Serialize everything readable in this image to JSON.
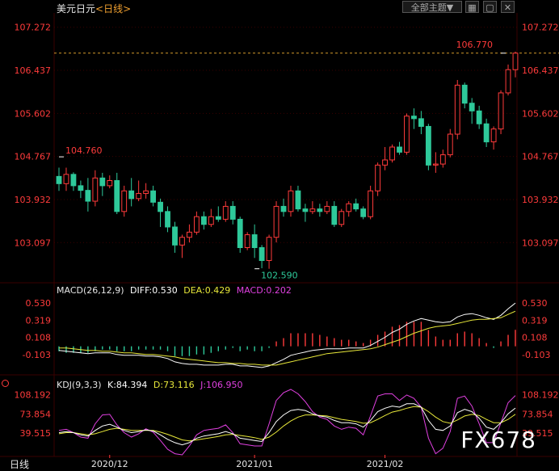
{
  "header": {
    "title": "美元日元",
    "period": "<日线>",
    "menu_label": "全部主题▼",
    "button_icons": [
      "grid-icon",
      "window-icon",
      "close-icon"
    ]
  },
  "bottom": {
    "period_label": "日线"
  },
  "watermark": "FX678",
  "colors": {
    "up": "#ff3b3b",
    "down": "#2ec99a",
    "axis": "#ff3b3b",
    "grid": "#3a0000",
    "diff": "#ffffff",
    "dea": "#e8e83a",
    "macd": "#e040e0",
    "k": "#ffffff",
    "d": "#e8e83a",
    "j": "#e040e0"
  },
  "chart_data": [
    {
      "type": "candlestick",
      "title": "美元日元<日线>",
      "y_ticks": [
        107.272,
        106.437,
        105.602,
        104.767,
        103.932,
        103.097
      ],
      "y_tick_labels": [
        "107.272",
        "106.437",
        "105.602",
        "104.767",
        "103.932",
        "103.097"
      ],
      "ylim": [
        102.35,
        107.55
      ],
      "x_tick_labels": [
        "2020/12",
        "2021/01",
        "2021/02"
      ],
      "x_tick_index": [
        7,
        27,
        45
      ],
      "annotations": [
        {
          "text": "104.760",
          "index": 0,
          "value": 104.76
        },
        {
          "text": "102.590",
          "index": 27,
          "value": 102.59
        },
        {
          "text": "106.770",
          "index": 61,
          "value": 106.77
        }
      ],
      "reference_line": 106.77,
      "candles": [
        [
          104.38,
          104.24,
          104.55,
          104.1
        ],
        [
          104.24,
          104.42,
          104.55,
          104.1
        ],
        [
          104.42,
          104.2,
          104.46,
          104.1
        ],
        [
          104.2,
          104.11,
          104.3,
          103.96
        ],
        [
          104.11,
          103.9,
          104.35,
          103.7
        ],
        [
          103.9,
          104.35,
          104.5,
          103.8
        ],
        [
          104.35,
          104.2,
          104.45,
          104.0
        ],
        [
          104.2,
          104.3,
          104.4,
          104.15
        ],
        [
          104.3,
          103.7,
          104.45,
          103.65
        ],
        [
          103.7,
          104.1,
          104.2,
          103.6
        ],
        [
          104.1,
          103.95,
          104.35,
          103.8
        ],
        [
          103.95,
          104.05,
          104.3,
          103.9
        ],
        [
          104.05,
          104.1,
          104.25,
          103.95
        ],
        [
          104.1,
          103.88,
          104.2,
          103.8
        ],
        [
          103.88,
          103.7,
          103.95,
          103.4
        ],
        [
          103.7,
          103.4,
          103.8,
          103.3
        ],
        [
          103.4,
          103.05,
          103.5,
          102.9
        ],
        [
          103.05,
          103.2,
          103.25,
          102.8
        ],
        [
          103.2,
          103.3,
          103.45,
          103.1
        ],
        [
          103.3,
          103.6,
          103.7,
          103.25
        ],
        [
          103.6,
          103.45,
          103.7,
          103.35
        ],
        [
          103.45,
          103.6,
          103.75,
          103.4
        ],
        [
          103.6,
          103.55,
          103.8,
          103.5
        ],
        [
          103.55,
          103.8,
          103.9,
          103.5
        ],
        [
          103.8,
          103.55,
          103.9,
          103.45
        ],
        [
          103.55,
          103.0,
          103.6,
          102.9
        ],
        [
          103.0,
          103.25,
          103.3,
          102.95
        ],
        [
          103.25,
          103.0,
          103.45,
          102.8
        ],
        [
          103.0,
          102.75,
          103.05,
          102.6
        ],
        [
          102.75,
          103.2,
          103.25,
          102.59
        ],
        [
          103.2,
          103.8,
          103.9,
          103.1
        ],
        [
          103.8,
          103.7,
          103.95,
          103.6
        ],
        [
          103.7,
          104.1,
          104.2,
          103.6
        ],
        [
          104.1,
          103.75,
          104.2,
          103.7
        ],
        [
          103.75,
          103.7,
          103.85,
          103.5
        ],
        [
          103.7,
          103.75,
          103.9,
          103.65
        ],
        [
          103.75,
          103.7,
          103.85,
          103.6
        ],
        [
          103.7,
          103.8,
          103.9,
          103.65
        ],
        [
          103.8,
          103.45,
          103.9,
          103.4
        ],
        [
          103.45,
          103.7,
          103.75,
          103.4
        ],
        [
          103.7,
          103.85,
          103.9,
          103.6
        ],
        [
          103.85,
          103.75,
          103.95,
          103.7
        ],
        [
          103.75,
          103.6,
          103.8,
          103.55
        ],
        [
          103.6,
          104.1,
          104.2,
          103.55
        ],
        [
          104.1,
          104.6,
          104.65,
          104.0
        ],
        [
          104.6,
          104.7,
          104.95,
          104.5
        ],
        [
          104.7,
          104.95,
          105.0,
          104.65
        ],
        [
          104.95,
          104.85,
          105.05,
          104.8
        ],
        [
          104.85,
          105.55,
          105.6,
          104.8
        ],
        [
          105.55,
          105.5,
          105.7,
          105.3
        ],
        [
          105.5,
          105.35,
          105.65,
          105.2
        ],
        [
          105.35,
          104.6,
          105.4,
          104.5
        ],
        [
          104.6,
          104.62,
          104.85,
          104.45
        ],
        [
          104.62,
          104.8,
          104.9,
          104.55
        ],
        [
          104.8,
          105.2,
          105.3,
          104.75
        ],
        [
          105.2,
          106.15,
          106.25,
          105.1
        ],
        [
          106.15,
          105.8,
          106.2,
          105.7
        ],
        [
          105.8,
          105.65,
          105.9,
          105.4
        ],
        [
          105.65,
          105.4,
          105.75,
          105.3
        ],
        [
          105.4,
          105.05,
          105.5,
          104.95
        ],
        [
          105.05,
          105.3,
          105.35,
          104.9
        ],
        [
          105.3,
          106.0,
          106.05,
          105.2
        ],
        [
          106.0,
          106.45,
          106.55,
          105.95
        ],
        [
          106.45,
          106.77,
          106.8,
          106.3
        ]
      ]
    },
    {
      "type": "macd",
      "title": "MACD(26,12,9)",
      "params": "(26,12,9)",
      "legend": {
        "diff": "DIFF:0.530",
        "dea": "DEA:0.429",
        "macd": "MACD:0.202"
      },
      "y_ticks": [
        0.53,
        0.319,
        0.108,
        -0.103
      ],
      "y_tick_labels": [
        "0.530",
        "0.319",
        "0.108",
        "-0.103"
      ],
      "ylim": [
        -0.33,
        0.62
      ],
      "diff": [
        -0.05,
        -0.06,
        -0.07,
        -0.08,
        -0.09,
        -0.08,
        -0.08,
        -0.08,
        -0.1,
        -0.11,
        -0.11,
        -0.11,
        -0.12,
        -0.12,
        -0.13,
        -0.15,
        -0.19,
        -0.21,
        -0.22,
        -0.22,
        -0.23,
        -0.23,
        -0.23,
        -0.22,
        -0.22,
        -0.24,
        -0.24,
        -0.25,
        -0.26,
        -0.24,
        -0.2,
        -0.16,
        -0.11,
        -0.09,
        -0.07,
        -0.05,
        -0.04,
        -0.03,
        -0.03,
        -0.03,
        -0.02,
        -0.02,
        -0.02,
        0.01,
        0.06,
        0.11,
        0.17,
        0.21,
        0.27,
        0.31,
        0.34,
        0.32,
        0.3,
        0.29,
        0.3,
        0.36,
        0.39,
        0.4,
        0.38,
        0.35,
        0.33,
        0.38,
        0.46,
        0.53
      ],
      "dea": [
        -0.02,
        -0.02,
        -0.03,
        -0.04,
        -0.05,
        -0.05,
        -0.06,
        -0.06,
        -0.07,
        -0.08,
        -0.08,
        -0.09,
        -0.1,
        -0.1,
        -0.11,
        -0.12,
        -0.13,
        -0.15,
        -0.16,
        -0.17,
        -0.18,
        -0.19,
        -0.2,
        -0.2,
        -0.21,
        -0.21,
        -0.22,
        -0.22,
        -0.23,
        -0.23,
        -0.23,
        -0.21,
        -0.19,
        -0.17,
        -0.15,
        -0.13,
        -0.11,
        -0.09,
        -0.08,
        -0.07,
        -0.06,
        -0.05,
        -0.04,
        -0.03,
        -0.01,
        0.02,
        0.05,
        0.08,
        0.12,
        0.16,
        0.19,
        0.22,
        0.24,
        0.25,
        0.26,
        0.28,
        0.3,
        0.32,
        0.33,
        0.33,
        0.34,
        0.35,
        0.39,
        0.43
      ],
      "macd": [
        -0.06,
        -0.08,
        -0.08,
        -0.08,
        -0.08,
        -0.06,
        -0.04,
        -0.04,
        -0.06,
        -0.06,
        -0.06,
        -0.04,
        -0.04,
        -0.04,
        -0.04,
        -0.06,
        -0.12,
        -0.12,
        -0.12,
        -0.1,
        -0.1,
        -0.08,
        -0.06,
        -0.04,
        -0.02,
        -0.06,
        -0.04,
        -0.06,
        -0.06,
        -0.02,
        0.06,
        0.1,
        0.16,
        0.16,
        0.16,
        0.16,
        0.14,
        0.12,
        0.1,
        0.08,
        0.08,
        0.06,
        0.04,
        0.08,
        0.14,
        0.18,
        0.24,
        0.26,
        0.3,
        0.3,
        0.3,
        0.2,
        0.12,
        0.08,
        0.08,
        0.16,
        0.18,
        0.16,
        0.1,
        0.04,
        -0.02,
        0.06,
        0.14,
        0.202
      ]
    },
    {
      "type": "kdj",
      "title": "KDJ(9,3,3)",
      "params": "(9,3,3)",
      "legend": {
        "k": "K:84.394",
        "d": "D:73.116",
        "j": "J:106.950"
      },
      "y_ticks": [
        108.192,
        73.854,
        39.515
      ],
      "y_tick_labels": [
        "108.192",
        "73.854",
        "39.515"
      ],
      "ylim": [
        0,
        118
      ],
      "k": [
        40,
        42,
        40,
        36,
        34,
        44,
        52,
        55,
        50,
        44,
        40,
        42,
        45,
        43,
        36,
        28,
        22,
        18,
        22,
        30,
        34,
        36,
        38,
        42,
        38,
        30,
        28,
        26,
        24,
        40,
        60,
        72,
        80,
        82,
        80,
        74,
        70,
        68,
        62,
        58,
        58,
        56,
        50,
        62,
        78,
        84,
        88,
        86,
        92,
        92,
        86,
        62,
        46,
        44,
        52,
        76,
        82,
        78,
        66,
        50,
        46,
        58,
        74,
        84.394
      ],
      "d": [
        38,
        40,
        40,
        38,
        36,
        38,
        42,
        46,
        48,
        46,
        44,
        44,
        44,
        44,
        41,
        37,
        32,
        27,
        25,
        27,
        29,
        31,
        33,
        36,
        37,
        35,
        33,
        31,
        28,
        32,
        41,
        52,
        61,
        68,
        72,
        72,
        71,
        70,
        67,
        64,
        62,
        60,
        57,
        58,
        64,
        71,
        77,
        80,
        84,
        87,
        86,
        78,
        68,
        60,
        57,
        63,
        70,
        73,
        71,
        64,
        58,
        58,
        64,
        73.116
      ],
      "j": [
        44,
        46,
        40,
        32,
        30,
        56,
        72,
        73,
        54,
        40,
        32,
        38,
        47,
        41,
        26,
        10,
        2,
        0,
        16,
        36,
        44,
        46,
        48,
        54,
        40,
        20,
        18,
        16,
        16,
        56,
        98,
        112,
        118,
        110,
        96,
        78,
        68,
        64,
        52,
        46,
        50,
        48,
        36,
        70,
        106,
        110,
        110,
        98,
        108,
        102,
        86,
        30,
        2,
        12,
        42,
        102,
        106,
        88,
        56,
        22,
        22,
        58,
        94,
        106.95
      ]
    }
  ]
}
